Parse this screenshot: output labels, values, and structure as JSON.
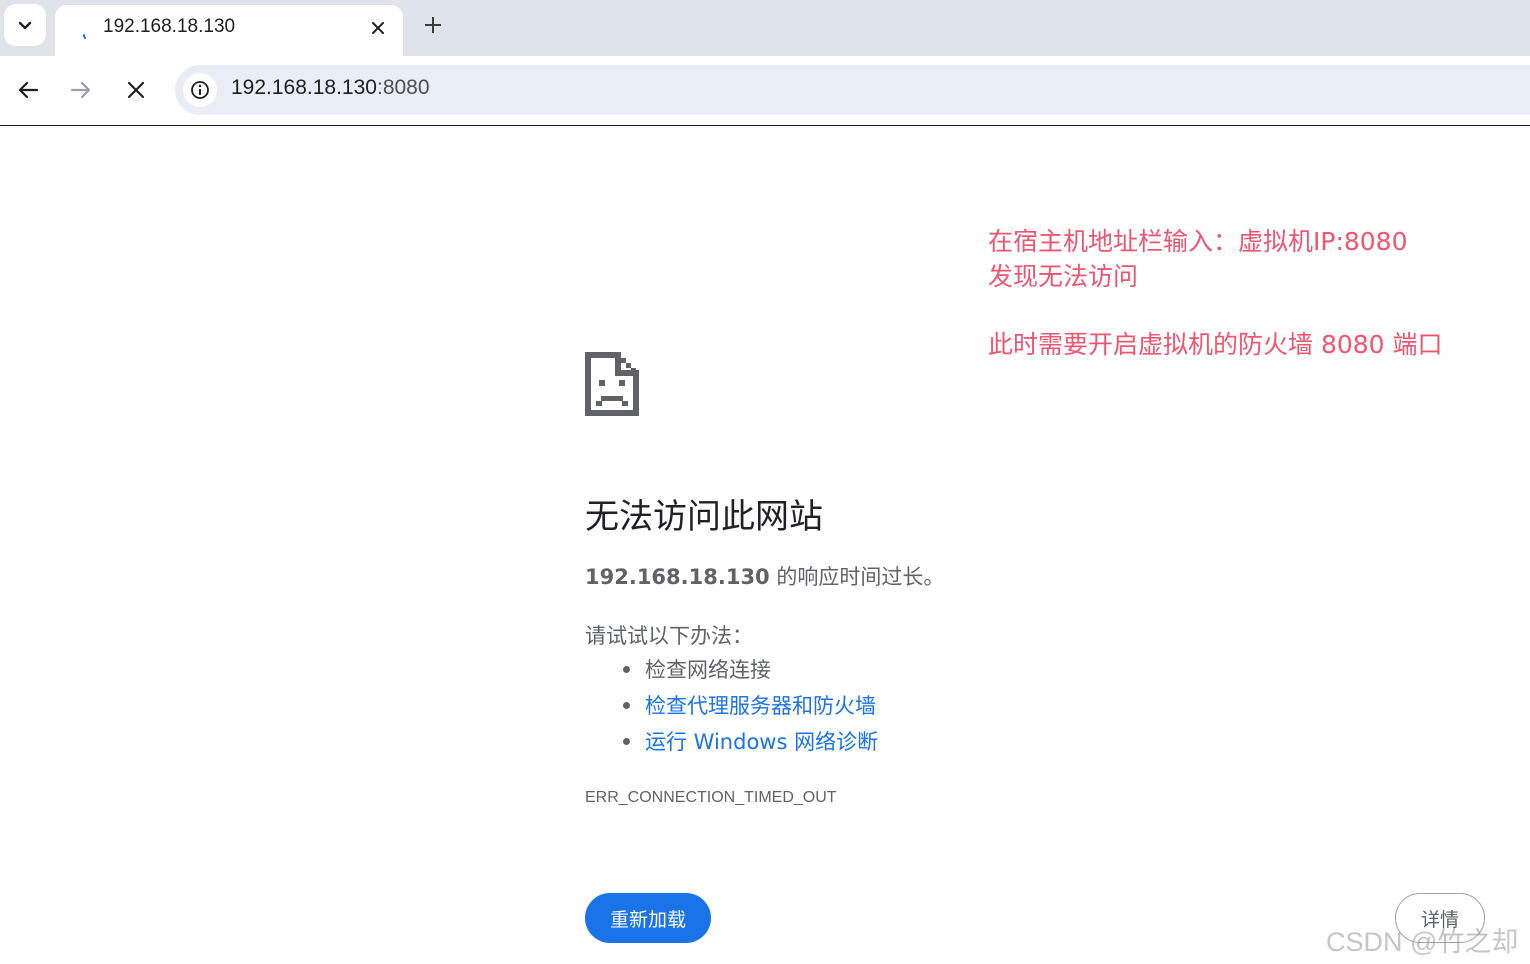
{
  "browser": {
    "tab_title": "192.168.18.130",
    "url_host": "192.168.18.130",
    "url_port": ":8080",
    "icons": [
      "tab-search-icon",
      "loading-spinner-icon",
      "tab-close-icon",
      "new-tab-icon",
      "back-arrow-icon",
      "forward-arrow-icon",
      "stop-loading-icon",
      "site-info-icon"
    ]
  },
  "annotation": {
    "line1": "在宿主机地址栏输入：虚拟机IP:8080",
    "line2": "发现无法访问",
    "line3": "此时需要开启虚拟机的防火墙 8080 端口",
    "color": "#f05570"
  },
  "error": {
    "icon": "sad-document-icon",
    "title": "无法访问此网站",
    "host": "192.168.18.130",
    "desc_suffix": " 的响应时间过长。",
    "try_label": "请试试以下办法：",
    "suggestions": [
      {
        "label": "检查网络连接",
        "link": false
      },
      {
        "label": "检查代理服务器和防火墙",
        "link": true
      },
      {
        "label": "运行 Windows 网络诊断",
        "link": true
      }
    ],
    "code": "ERR_CONNECTION_TIMED_OUT",
    "reload_label": "重新加载",
    "details_label": "详情",
    "accent": "#1a73e8"
  },
  "watermark": "CSDN @竹之却"
}
